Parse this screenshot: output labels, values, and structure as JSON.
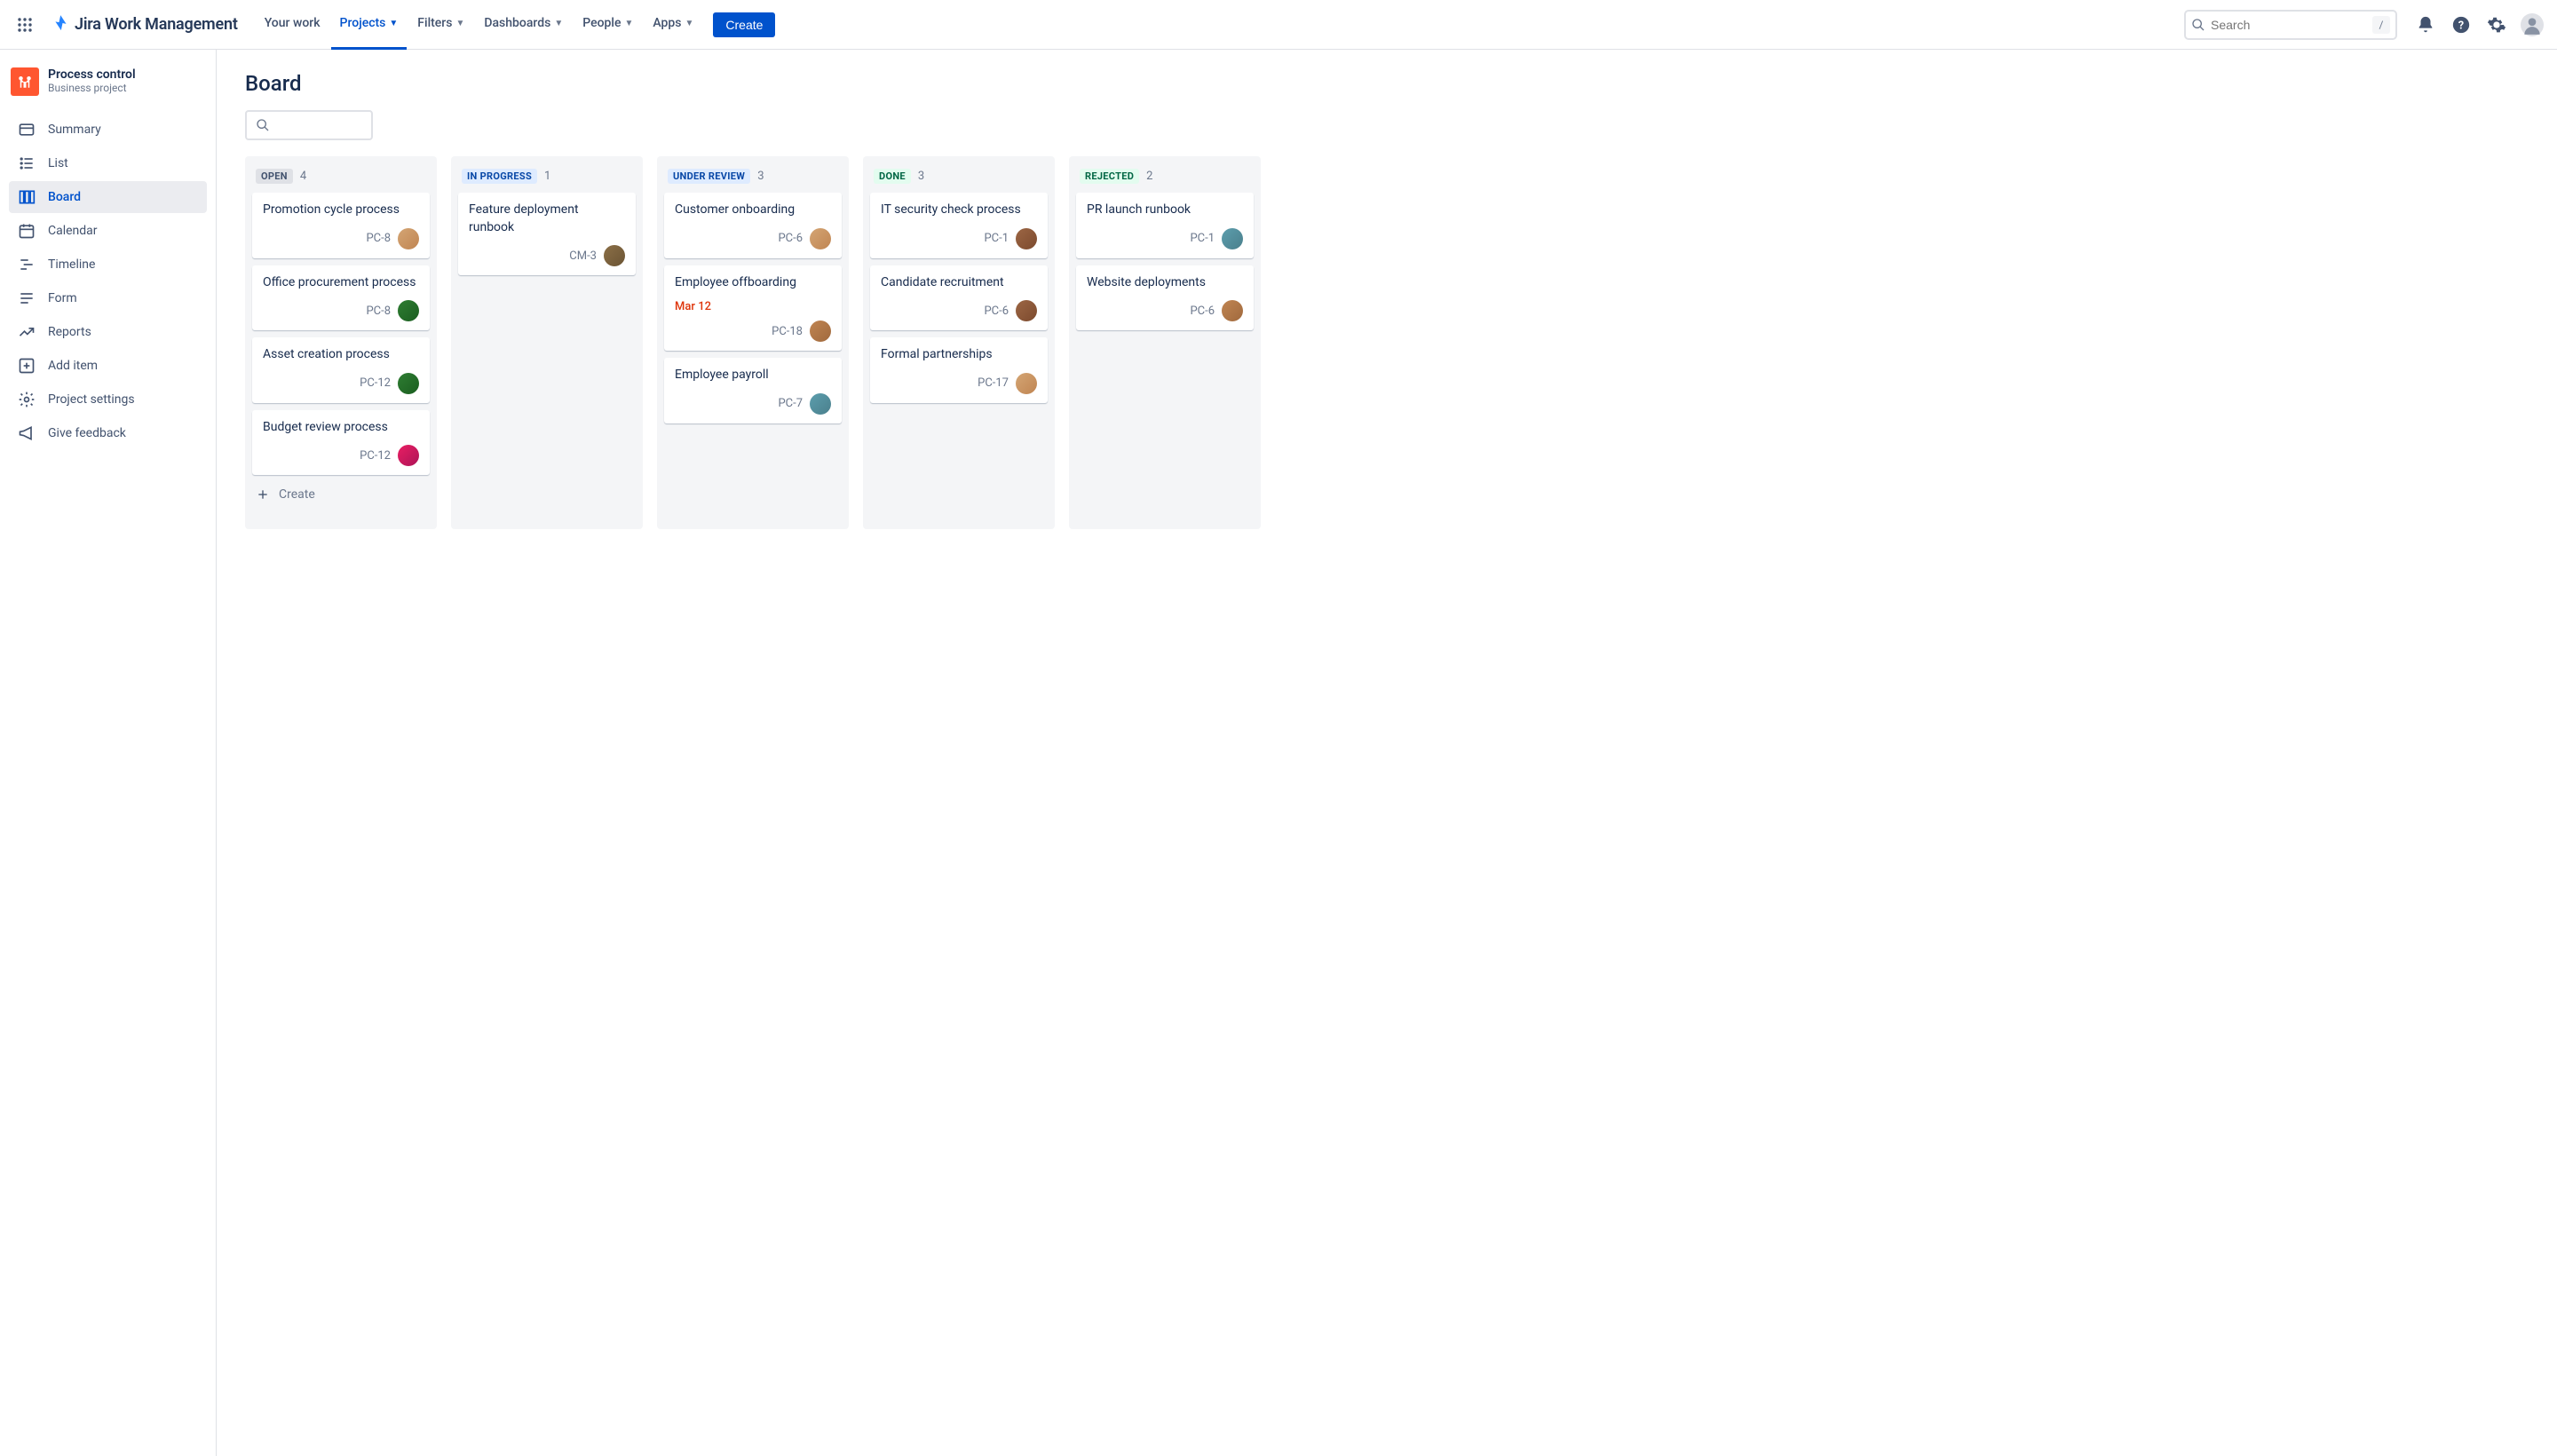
{
  "topnav": {
    "product": "Jira Work Management",
    "items": [
      "Your work",
      "Projects",
      "Filters",
      "Dashboards",
      "People",
      "Apps"
    ],
    "active_index": 1,
    "create_label": "Create",
    "search_placeholder": "Search",
    "slash": "/"
  },
  "sidebar": {
    "project_name": "Process control",
    "project_type": "Business project",
    "items": [
      {
        "label": "Summary",
        "icon": "card"
      },
      {
        "label": "List",
        "icon": "list"
      },
      {
        "label": "Board",
        "icon": "board"
      },
      {
        "label": "Calendar",
        "icon": "calendar"
      },
      {
        "label": "Timeline",
        "icon": "timeline"
      },
      {
        "label": "Form",
        "icon": "form"
      },
      {
        "label": "Reports",
        "icon": "reports"
      },
      {
        "label": "Add item",
        "icon": "add"
      },
      {
        "label": "Project settings",
        "icon": "settings"
      },
      {
        "label": "Give feedback",
        "icon": "feedback"
      }
    ],
    "active_index": 2
  },
  "page": {
    "title": "Board"
  },
  "board": {
    "create_label": "Create",
    "columns": [
      {
        "title": "OPEN",
        "class": "c-open",
        "count": 4,
        "cards": [
          {
            "title": "Promotion cycle process",
            "key": "PC-8",
            "avatar": "av1"
          },
          {
            "title": "Office procurement process",
            "key": "PC-8",
            "avatar": "av3"
          },
          {
            "title": "Asset creation process",
            "key": "PC-12",
            "avatar": "av3"
          },
          {
            "title": "Budget review process",
            "key": "PC-12",
            "avatar": "av4"
          }
        ],
        "show_create": true
      },
      {
        "title": "IN PROGRESS",
        "class": "c-progress",
        "count": 1,
        "cards": [
          {
            "title": "Feature deployment runbook",
            "key": "CM-3",
            "avatar": "av2"
          }
        ]
      },
      {
        "title": "UNDER REVIEW",
        "class": "c-review",
        "count": 3,
        "cards": [
          {
            "title": "Customer onboarding",
            "key": "PC-6",
            "avatar": "av1"
          },
          {
            "title": "Employee offboarding",
            "date": "Mar 12",
            "key": "PC-18",
            "avatar": "av6"
          },
          {
            "title": "Employee payroll",
            "key": "PC-7",
            "avatar": "av5"
          }
        ]
      },
      {
        "title": "DONE",
        "class": "c-done",
        "count": 3,
        "cards": [
          {
            "title": "IT security check process",
            "key": "PC-1",
            "avatar": "av7"
          },
          {
            "title": "Candidate recruitment",
            "key": "PC-6",
            "avatar": "av7"
          },
          {
            "title": "Formal partnerships",
            "key": "PC-17",
            "avatar": "av1"
          }
        ]
      },
      {
        "title": "REJECTED",
        "class": "c-rejected",
        "count": 2,
        "cards": [
          {
            "title": "PR launch runbook",
            "key": "PC-1",
            "avatar": "av5"
          },
          {
            "title": "Website deployments",
            "key": "PC-6",
            "avatar": "av6"
          }
        ]
      }
    ]
  }
}
